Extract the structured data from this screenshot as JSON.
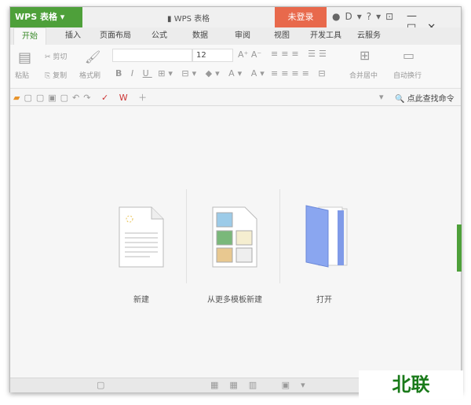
{
  "app": {
    "menu_label": "WPS 表格",
    "window_title": "WPS 表格",
    "login": "未登录"
  },
  "tabs": [
    "开始",
    "插入",
    "页面布局",
    "公式",
    "数据",
    "审阅",
    "视图",
    "开发工具",
    "云服务"
  ],
  "ribbon": {
    "paste": "粘贴",
    "cut": "剪切",
    "copy": "复制",
    "format_painter": "格式刷",
    "font_size": "12",
    "merge_center": "合并居中",
    "wrap_text": "自动换行"
  },
  "search": {
    "label": "点此查找命令"
  },
  "start": {
    "items": [
      {
        "label": "新建"
      },
      {
        "label": "从更多模板新建"
      },
      {
        "label": "打开"
      }
    ]
  },
  "watermark": "北联",
  "colors": {
    "accent": "#4ea03a",
    "login": "#e8694c"
  }
}
